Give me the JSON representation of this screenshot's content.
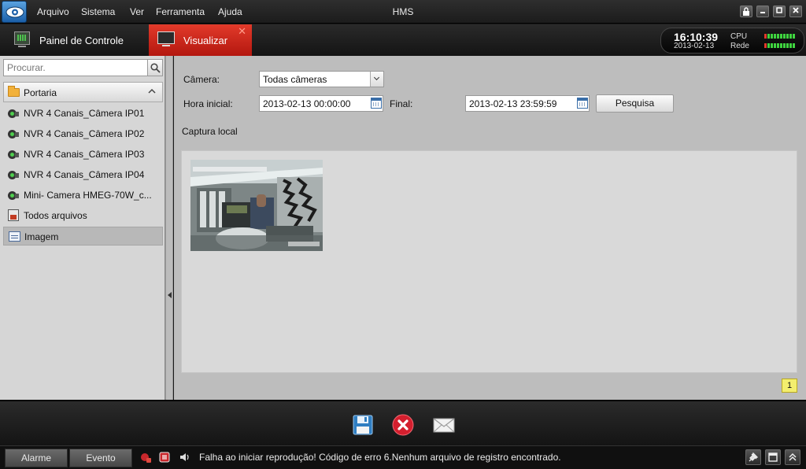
{
  "menubar": {
    "items": [
      "Arquivo",
      "Sistema",
      "Ver",
      "Ferramenta",
      "Ajuda"
    ],
    "title": "HMS"
  },
  "tabs": {
    "control_panel": "Painel de Controle",
    "view": "Visualizar"
  },
  "status_panel": {
    "time": "16:10:39",
    "date": "2013-02-13",
    "cpu_label": "CPU",
    "network_label": "Rede"
  },
  "sidebar": {
    "search_placeholder": "Procurar.",
    "group_label": "Portaria",
    "items": [
      "NVR 4 Canais_Câmera IP01",
      "NVR 4 Canais_Câmera IP02",
      "NVR 4 Canais_Câmera IP03",
      "NVR 4 Canais_Câmera IP04",
      "Mini- Camera HMEG-70W_c..."
    ],
    "all_files": "Todos arquivos",
    "image": "Imagem"
  },
  "search_form": {
    "camera_label": "Câmera:",
    "camera_value": "Todas câmeras",
    "start_label": "Hora inicial:",
    "start_value": "2013-02-13 00:00:00",
    "end_label": "Final:",
    "end_value": "2013-02-13 23:59:59",
    "search_button": "Pesquisa"
  },
  "capture": {
    "section_label": "Captura local",
    "page_number": "1"
  },
  "statusbar": {
    "tab_alarm": "Alarme",
    "tab_event": "Evento",
    "message": "Falha ao iniciar reprodução! Código de erro 6.Nenhum arquivo de registro encontrado."
  },
  "icons": {
    "save": "save-icon",
    "delete": "delete-icon",
    "email": "email-icon"
  },
  "colors": {
    "active_tab": "#d3241a",
    "meter_green": "#3fd43f",
    "meter_red": "#e03a2a",
    "page_badge": "#f3ee6e"
  }
}
